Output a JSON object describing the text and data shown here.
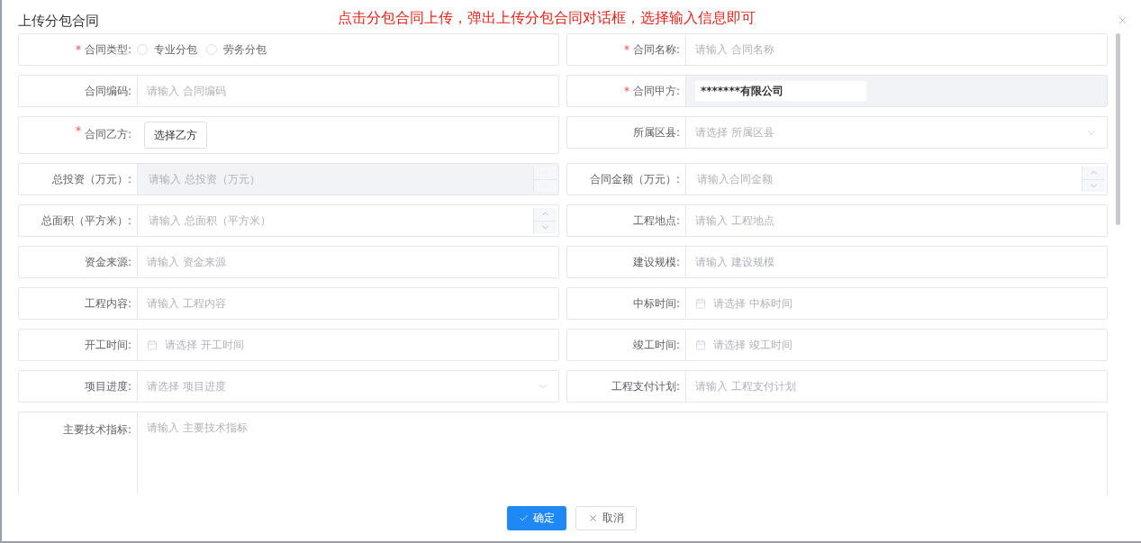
{
  "dialog": {
    "title": "上传分包合同",
    "annotation": "点击分包合同上传，弹出上传分包合同对话框，选择输入信息即可"
  },
  "fields": [
    {
      "label": "合同类型:",
      "required": true,
      "kind": "radio",
      "options": [
        {
          "label": "专业分包",
          "selected": false
        },
        {
          "label": "劳务分包",
          "selected": false
        }
      ]
    },
    {
      "label": "合同名称:",
      "required": true,
      "kind": "text",
      "placeholder": "请输入 合同名称"
    },
    {
      "label": "合同编码:",
      "required": false,
      "kind": "text",
      "placeholder": "请输入 合同编码"
    },
    {
      "label": "合同甲方:",
      "required": true,
      "kind": "value",
      "value": "*******有限公司",
      "disabled": true
    },
    {
      "label": "合同乙方:",
      "required": true,
      "kind": "button",
      "button": "选择乙方"
    },
    {
      "label": "所属区县:",
      "required": false,
      "kind": "select",
      "placeholder": "请选择 所属区县"
    },
    {
      "label": "总投资（万元）:",
      "required": false,
      "kind": "number",
      "placeholder": "请输入 总投资（万元）",
      "disabled": true
    },
    {
      "label": "合同金额（万元）:",
      "required": false,
      "kind": "number",
      "placeholder": "请输入合同金额",
      "disabled": false
    },
    {
      "label": "总面积（平方米）:",
      "required": false,
      "kind": "number",
      "placeholder": "请输入 总面积（平方米）",
      "disabled": false
    },
    {
      "label": "工程地点:",
      "required": false,
      "kind": "text",
      "placeholder": "请输入 工程地点"
    },
    {
      "label": "资金来源:",
      "required": false,
      "kind": "text",
      "placeholder": "请输入 资金来源"
    },
    {
      "label": "建设规模:",
      "required": false,
      "kind": "text",
      "placeholder": "请输入 建设规模"
    },
    {
      "label": "工程内容:",
      "required": false,
      "kind": "text",
      "placeholder": "请输入 工程内容"
    },
    {
      "label": "中标时间:",
      "required": false,
      "kind": "date",
      "placeholder": "请选择 中标时间"
    },
    {
      "label": "开工时间:",
      "required": false,
      "kind": "date",
      "placeholder": "请选择 开工时间"
    },
    {
      "label": "竣工时间:",
      "required": false,
      "kind": "date",
      "placeholder": "请选择 竣工时间"
    },
    {
      "label": "项目进度:",
      "required": false,
      "kind": "select",
      "placeholder": "请选择 项目进度"
    },
    {
      "label": "工程支付计划:",
      "required": false,
      "kind": "text",
      "placeholder": "请输入 工程支付计划"
    },
    {
      "label": "主要技术指标:",
      "required": false,
      "kind": "textarea",
      "placeholder": "请输入 主要技术指标"
    }
  ],
  "buttons": [
    {
      "label": "确定",
      "kind": "primary"
    },
    {
      "label": "取消",
      "kind": "default"
    }
  ]
}
